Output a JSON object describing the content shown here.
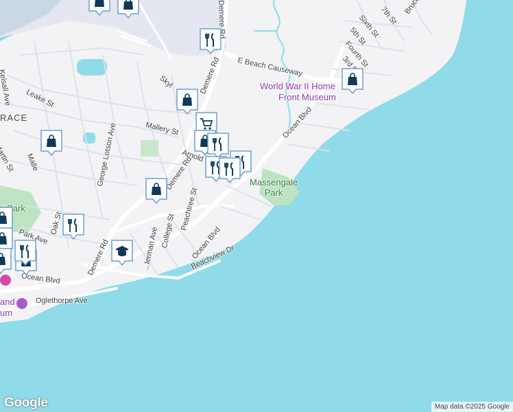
{
  "map": {
    "colors": {
      "water": "#8fdbe9",
      "land": "#f3f3f5",
      "airport": "#e4e7f0",
      "park": "#bde3c2",
      "road": "#ffffff",
      "road_minor": "#dde1e8",
      "pin_fill": "#ffffff",
      "pin_icon": "#0e3a5a"
    },
    "labels": {
      "kelsall": "Kelsall Ave",
      "leake": "Leake St",
      "terrace": "RACE",
      "martin": "Martin St",
      "mallery_st_w": "Malle",
      "george_lotson": "George Lotson Ave",
      "mallery": "Mallery St",
      "skylane": "Skyl",
      "demere_n": "Demere Rd",
      "demere_mid": "Demere Rd",
      "demere_s": "Demere Rd",
      "arnold": "Arnold",
      "e_beach_causeway": "E Beach Causeway",
      "ocean_blvd_ne": "Ocean Blvd",
      "ocean_blvd_mid": "Ocean Blvd",
      "ocean_blvd_sw": "Ocean Blvd",
      "peachtree": "Peachtree St",
      "college": "College St",
      "kimberman": "...lerman Ave",
      "beachview": "Beachview Dr",
      "oak": "Oak St",
      "park_ave": "Park Ave",
      "oglethorpe": "Oglethorpe Ave",
      "seventh": "7th St",
      "sixth": "Sixth St",
      "fifth": "5th St",
      "fourth": "Fourth St",
      "third": "3rd St",
      "bruce": "Bruce",
      "museum_line1": "World War II Home",
      "museum_line2": "Front Museum",
      "park_line1": "Massengale",
      "park_line2": "Park",
      "neptune_park": "y Park",
      "island_museum": "and",
      "island_museum2": "um"
    },
    "pins": [
      {
        "id": "pin-shop-top-1",
        "icon": "shopping-bag-icon"
      },
      {
        "id": "pin-shop-top-2",
        "icon": "shopping-bag-icon"
      },
      {
        "id": "pin-restaurant-1",
        "icon": "restaurant-icon"
      },
      {
        "id": "pin-shop-museum",
        "icon": "shopping-bag-icon"
      },
      {
        "id": "pin-shop-demere",
        "icon": "shopping-bag-icon"
      },
      {
        "id": "pin-grocery",
        "icon": "shopping-cart-icon"
      },
      {
        "id": "pin-shop-mallery",
        "icon": "shopping-bag-icon"
      },
      {
        "id": "pin-restaurant-2",
        "icon": "restaurant-icon"
      },
      {
        "id": "pin-shop-west",
        "icon": "shopping-bag-icon"
      },
      {
        "id": "pin-restaurant-3",
        "icon": "restaurant-icon"
      },
      {
        "id": "pin-restaurant-4",
        "icon": "restaurant-icon"
      },
      {
        "id": "pin-restaurant-5",
        "icon": "restaurant-icon"
      },
      {
        "id": "pin-shop-college",
        "icon": "shopping-bag-icon"
      },
      {
        "id": "pin-restaurant-oak",
        "icon": "restaurant-icon"
      },
      {
        "id": "pin-school",
        "icon": "school-icon"
      },
      {
        "id": "pin-shop-sw-1",
        "icon": "shopping-bag-icon"
      },
      {
        "id": "pin-restaurant-sw",
        "icon": "restaurant-icon"
      }
    ]
  },
  "branding": {
    "logo": "Google"
  },
  "attribution": "Map data ©2025 Google"
}
